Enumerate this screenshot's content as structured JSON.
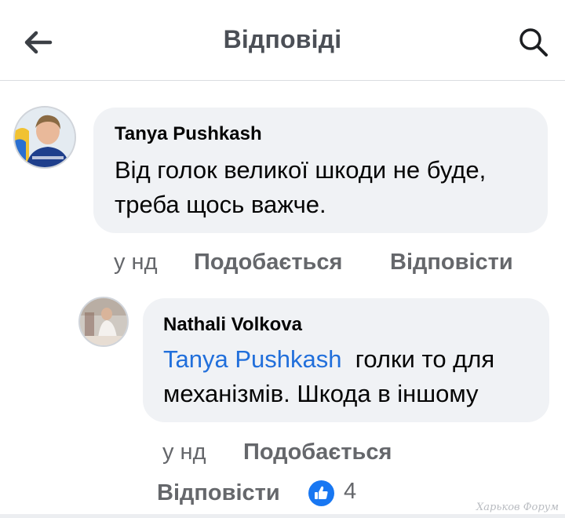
{
  "header": {
    "title": "Відповіді",
    "back_icon": "arrow-left-icon",
    "search_icon": "search-icon"
  },
  "comments": [
    {
      "author": "Tanya Pushkash",
      "text_lines": [
        "Від голок великої шкоди не буде,",
        "треба щось важче."
      ],
      "time": "у нд",
      "like_label": "Подобається",
      "reply_label": "Відповісти"
    },
    {
      "author": "Nathali  Volkova",
      "mention": "Tanya Pushkash",
      "text_line1_rest": "  голки то для",
      "text_line2": "механізмів. Шкода в іншому",
      "time": "у нд",
      "like_label": "Подобається",
      "reply_label": "Відповісти",
      "reaction_icon": "thumbs-up-icon",
      "reaction_count": "4"
    }
  ],
  "watermark": "Харьков Форум",
  "colors": {
    "mention": "#216fdb",
    "bubble": "#f0f2f5",
    "muted": "#65676b",
    "like_blue": "#1877f2"
  }
}
